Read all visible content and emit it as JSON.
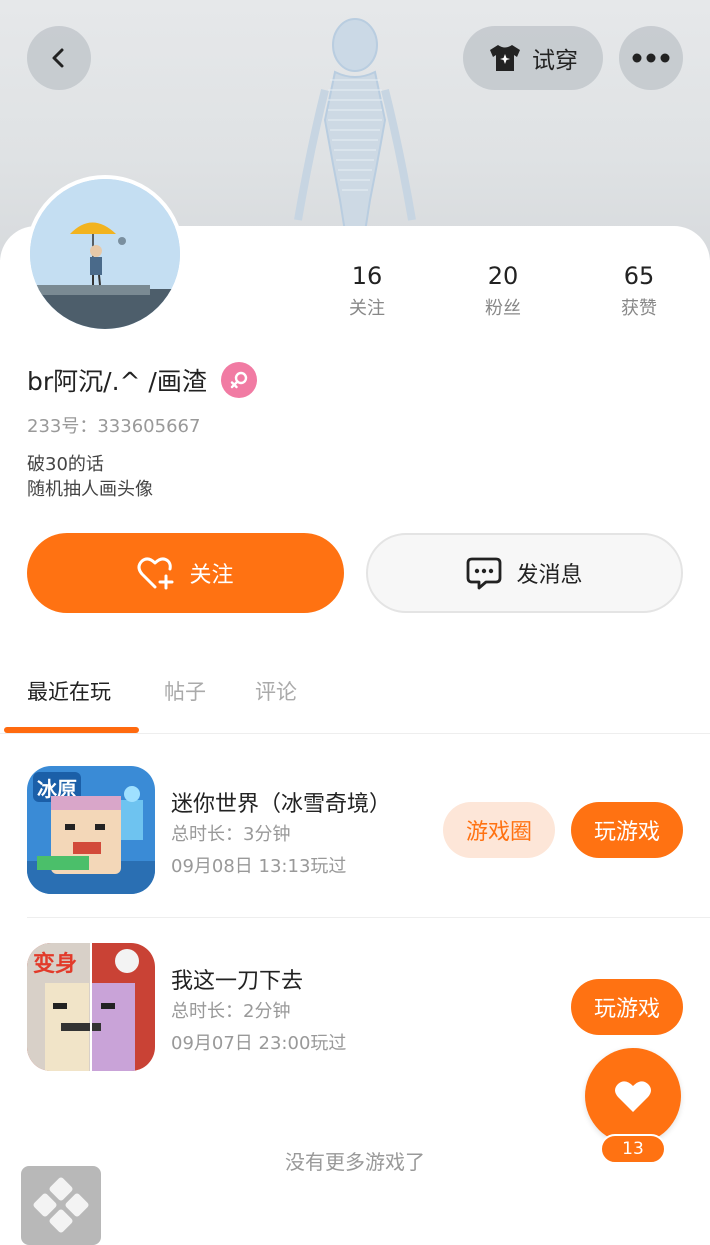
{
  "header": {
    "back_icon": "back-chevron-icon",
    "tryon_label": "试穿",
    "tryon_icon": "tshirt-sparkle-icon",
    "more_icon": "more-dots-icon"
  },
  "profile": {
    "stats": [
      {
        "value": "16",
        "label": "关注"
      },
      {
        "value": "20",
        "label": "粉丝"
      },
      {
        "value": "65",
        "label": "获赞"
      }
    ],
    "username": "br阿沉/.^ /画渣",
    "gender_icon": "female-icon",
    "uid": "233号：333605667",
    "bio_lines": [
      "破30的话",
      "随机抽人画头像"
    ]
  },
  "actions": {
    "follow_label": "关注",
    "message_label": "发消息"
  },
  "tabs": [
    {
      "label": "最近在玩",
      "active": true
    },
    {
      "label": "帖子",
      "active": false
    },
    {
      "label": "评论",
      "active": false
    }
  ],
  "games": [
    {
      "title": "迷你世界（冰雪奇境）",
      "duration": "总时长：3分钟",
      "last_played": "09月08日 13:13玩过",
      "community_label": "游戏圈",
      "play_label": "玩游戏"
    },
    {
      "title": "我这一刀下去",
      "duration": "总时长：2分钟",
      "last_played": "09月07日 23:00玩过",
      "play_label": "玩游戏"
    }
  ],
  "footer": {
    "no_more_text": "没有更多游戏了"
  },
  "fab": {
    "icon": "heart-icon",
    "count": "13"
  },
  "colors": {
    "accent": "#ff7212",
    "accent_light": "#fde6d8",
    "gender_pink": "#f17ba3"
  }
}
